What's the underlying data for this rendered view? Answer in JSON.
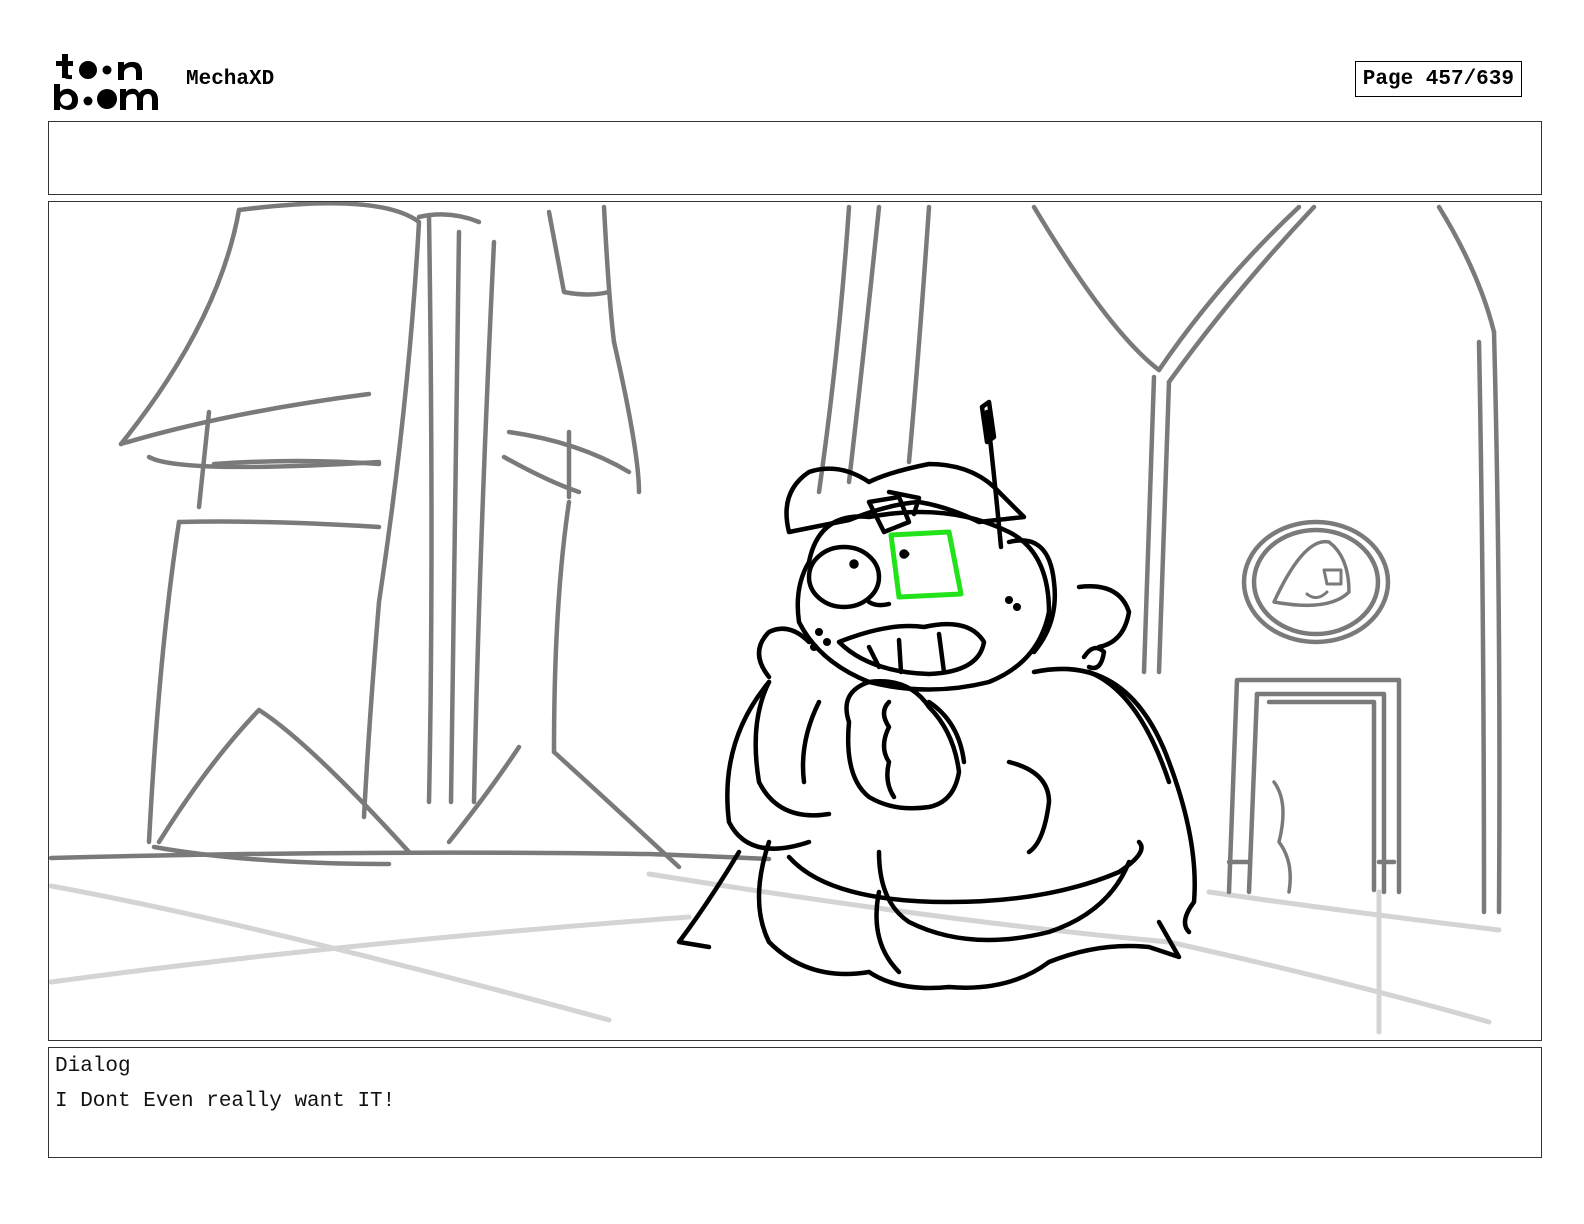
{
  "header": {
    "logo_text_top": "toon",
    "logo_text_bottom": "boom",
    "project_title": "MechaXD",
    "page_label": "Page 457/639"
  },
  "notes": {
    "text": ""
  },
  "panel": {
    "description_icons": [
      "character-sketch",
      "room-background",
      "wall-emblem",
      "doorway"
    ]
  },
  "dialog": {
    "label": "Dialog",
    "text": "I Dont Even really want IT!"
  },
  "colors": {
    "border": "#333333",
    "background_lines": "#777777",
    "floor_lines": "#d2d2d2",
    "character_lines": "#000000",
    "highlight": "#22e31a"
  }
}
